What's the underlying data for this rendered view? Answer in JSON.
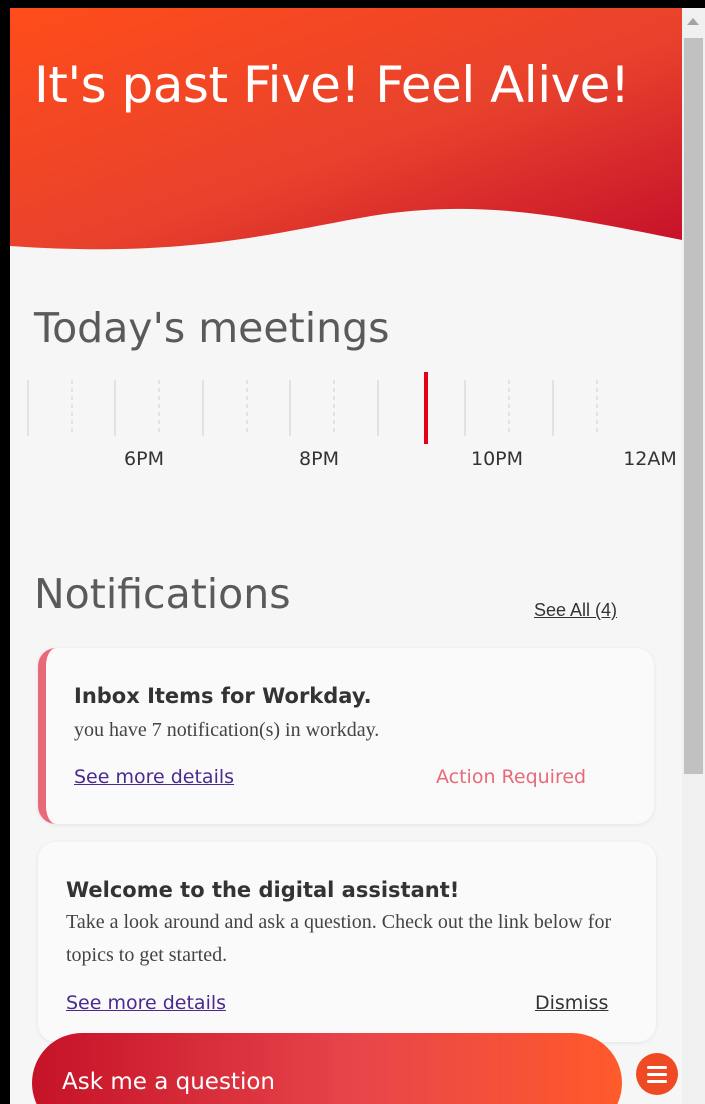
{
  "hero": {
    "title": "It's past Five! Feel Alive!"
  },
  "meetings": {
    "title": "Today's meetings",
    "tick_labels": [
      "6PM",
      "8PM",
      "10PM",
      "12AM"
    ]
  },
  "notifications": {
    "title": "Notifications",
    "see_all": "See All (4)",
    "cards": [
      {
        "title": "Inbox Items for Workday.",
        "body": "you have 7 notification(s) in workday.",
        "link": "See more details",
        "status": "Action Required"
      },
      {
        "title": "Welcome to the digital assistant!",
        "body": "Take a look around and ask a question. Check out the link below for topics to get started.",
        "link": "See more details",
        "action": "Dismiss"
      }
    ]
  },
  "ask": {
    "label": "Ask me a question"
  },
  "icons": {
    "menu": "hamburger-menu-icon",
    "scroll_up": "arrow-up-icon"
  },
  "colors": {
    "accent_red": "#e3261f",
    "accent_orange": "#ff5a1a",
    "alert_pink": "#e86a7a",
    "link_purple": "#4b2a8f"
  }
}
